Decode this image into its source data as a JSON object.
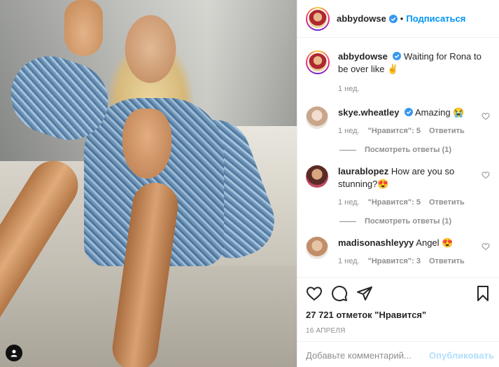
{
  "post": {
    "author": "abbydowse",
    "follow_label": "Подписаться",
    "caption": "Waiting for Rona to be over like ✌️",
    "caption_time": "1 нед."
  },
  "comments": [
    {
      "user": "skye.wheatley",
      "verified": true,
      "text": "Amazing 😭",
      "time": "1 нед.",
      "likes": "\"Нравится\": 5",
      "reply_label": "Ответить",
      "view_replies": "Посмотреть ответы (1)"
    },
    {
      "user": "laurablopez",
      "verified": false,
      "text": "How are you so stunning?😍",
      "time": "1 нед.",
      "likes": "\"Нравится\": 5",
      "reply_label": "Ответить",
      "view_replies": "Посмотреть ответы (1)"
    },
    {
      "user": "madisonashleyyy",
      "verified": false,
      "text": "Angel 😍",
      "time": "1 нед.",
      "likes": "\"Нравится\": 3",
      "reply_label": "Ответить"
    }
  ],
  "footer": {
    "likes_count": "27 721 отметок \"Нравится\"",
    "date": "16 АПРЕЛЯ",
    "comment_placeholder": "Добавьте комментарий...",
    "post_label": "Опубликовать"
  },
  "colors": {
    "link": "#0095f6",
    "muted": "#8e8e8e",
    "post_disabled": "#b2dffc"
  }
}
